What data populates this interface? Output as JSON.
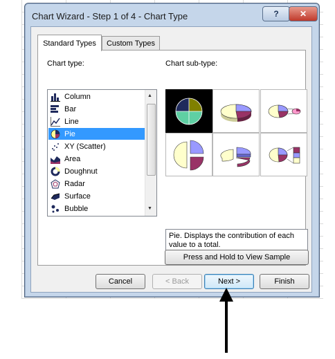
{
  "window": {
    "title": "Chart Wizard - Step 1 of 4 - Chart Type",
    "help_label": "?",
    "close_label": "✕"
  },
  "tabs": [
    {
      "label": "Standard Types",
      "active": true
    },
    {
      "label": "Custom Types",
      "active": false
    }
  ],
  "chart_type": {
    "label": "Chart type:",
    "items": [
      {
        "label": "Column",
        "icon": "column-chart-icon"
      },
      {
        "label": "Bar",
        "icon": "bar-chart-icon"
      },
      {
        "label": "Line",
        "icon": "line-chart-icon"
      },
      {
        "label": "Pie",
        "icon": "pie-chart-icon",
        "selected": true
      },
      {
        "label": "XY (Scatter)",
        "icon": "scatter-chart-icon"
      },
      {
        "label": "Area",
        "icon": "area-chart-icon"
      },
      {
        "label": "Doughnut",
        "icon": "doughnut-chart-icon"
      },
      {
        "label": "Radar",
        "icon": "radar-chart-icon"
      },
      {
        "label": "Surface",
        "icon": "surface-chart-icon"
      },
      {
        "label": "Bubble",
        "icon": "bubble-chart-icon"
      }
    ]
  },
  "chart_subtype": {
    "label": "Chart sub-type:",
    "items": [
      {
        "name": "pie",
        "selected": true
      },
      {
        "name": "pie-3d"
      },
      {
        "name": "pie-of-pie"
      },
      {
        "name": "exploded-pie"
      },
      {
        "name": "exploded-pie-3d"
      },
      {
        "name": "bar-of-pie"
      }
    ]
  },
  "description": "Pie. Displays the contribution of each value to a total.",
  "sample_button": "Press and Hold to View Sample",
  "buttons": {
    "cancel": "Cancel",
    "back": "< Back",
    "next": "Next >",
    "finish": "Finish"
  },
  "colors": {
    "pie_slice_1": "#9999ff",
    "pie_slice_2": "#993366",
    "pie_slice_3": "#ffffcc",
    "pie_slice_4": "#ccffff",
    "pie_selected_olive": "#808000",
    "pie_selected_navy": "#1f2a5c",
    "pie_selected_teal": "#5fcfa3",
    "selection": "#3399ff"
  }
}
